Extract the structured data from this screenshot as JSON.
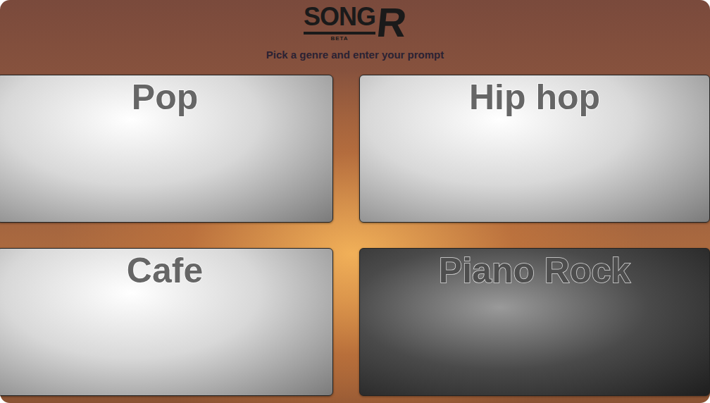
{
  "header": {
    "logo": "SONG",
    "logo_mark": "R",
    "badge": "BETA",
    "subtitle": "Pick a genre and enter your prompt"
  },
  "genres": [
    {
      "label": "Pop",
      "kind": "light"
    },
    {
      "label": "Hip hop",
      "kind": "light"
    },
    {
      "label": "Cafe",
      "kind": "light"
    },
    {
      "label": "Piano Rock",
      "kind": "dark"
    }
  ]
}
